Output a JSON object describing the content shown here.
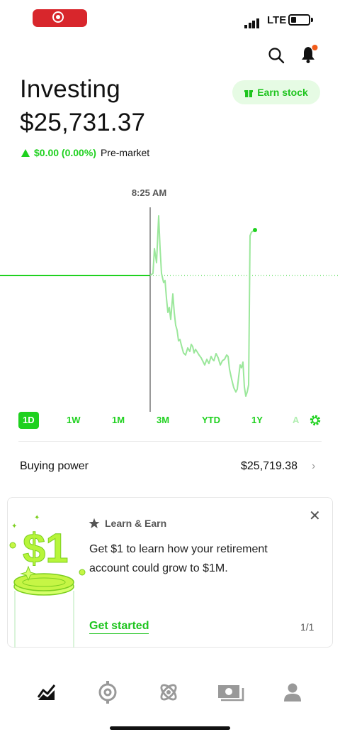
{
  "status_bar": {
    "network": "LTE",
    "battery_level": 0.3
  },
  "header": {
    "title": "Investing",
    "portfolio_value": "$25,731.37",
    "change": "$0.00 (0.00%)",
    "session": "Pre-market",
    "earn_button": "Earn stock",
    "search_icon": "search-icon",
    "bell_icon": "bell-icon"
  },
  "chart": {
    "time_label": "8:25 AM",
    "accent_color": "#1fd11f",
    "line_color": "#9be79b"
  },
  "ranges": [
    "1D",
    "1W",
    "1M",
    "3M",
    "YTD",
    "1Y",
    "A"
  ],
  "active_range": "1D",
  "buying_power": {
    "label": "Buying power",
    "value": "$25,719.38"
  },
  "promo": {
    "tag": "Learn & Earn",
    "text": "Get $1 to learn how your retirement account could grow to $1M.",
    "cta": "Get started",
    "page": "1/1",
    "illustration_text": "$1"
  },
  "tabs": [
    "chart-icon",
    "crypto-icon",
    "network-icon",
    "cash-icon",
    "profile-icon"
  ]
}
